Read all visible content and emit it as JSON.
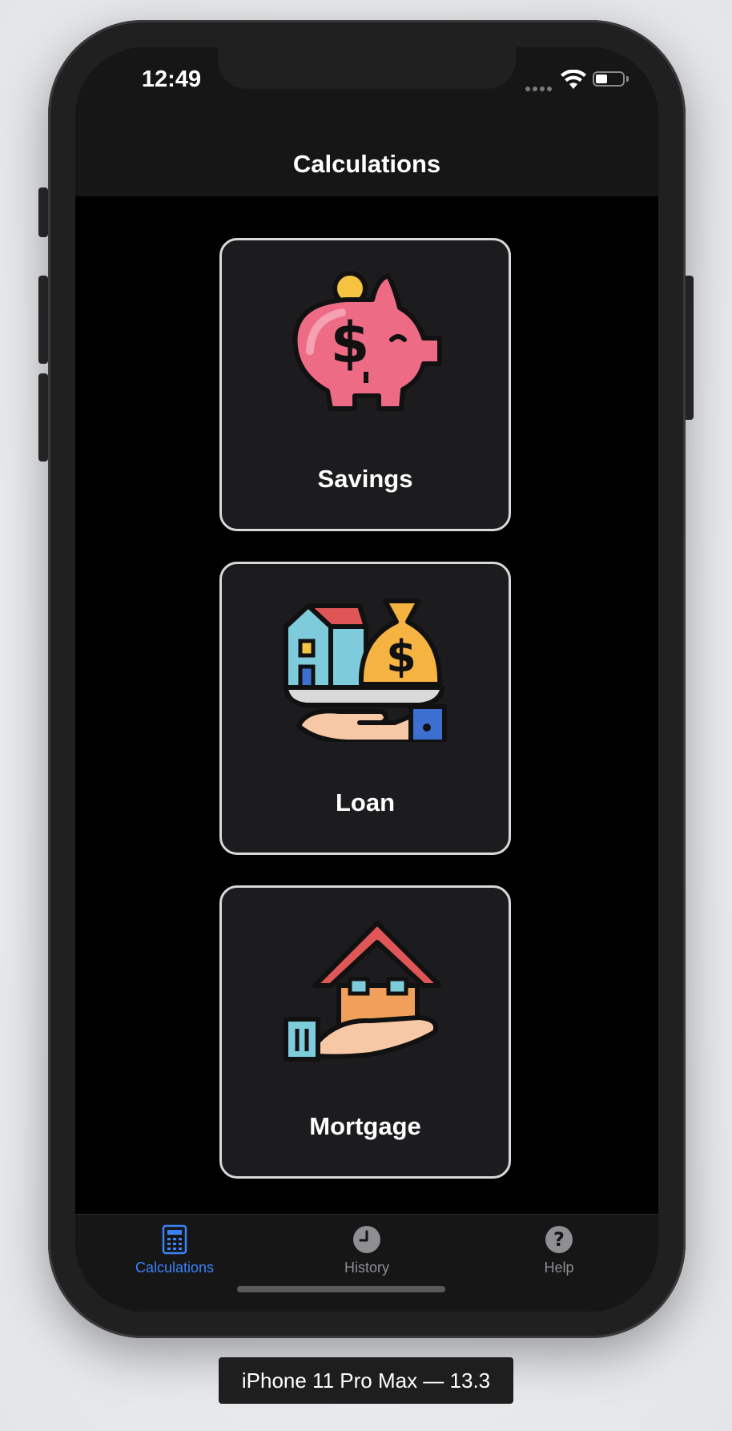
{
  "status_bar": {
    "time": "12:49",
    "battery_level": 0.45
  },
  "nav": {
    "title": "Calculations"
  },
  "cards": [
    {
      "label": "Savings",
      "icon": "piggy-bank-icon"
    },
    {
      "label": "Loan",
      "icon": "loan-money-bag-icon"
    },
    {
      "label": "Mortgage",
      "icon": "mortgage-house-icon"
    }
  ],
  "tabs": [
    {
      "label": "Calculations",
      "icon": "calculator-icon",
      "selected": true
    },
    {
      "label": "History",
      "icon": "clock-icon",
      "selected": false
    },
    {
      "label": "Help",
      "icon": "question-icon",
      "selected": false
    }
  ],
  "colors": {
    "accent": "#3b82f6",
    "inactive_tab": "#8e8e93",
    "background": "#000000",
    "card_background": "#1c1c1e",
    "card_border": "#d8d8d8"
  },
  "device_label": "iPhone 11 Pro Max — 13.3"
}
